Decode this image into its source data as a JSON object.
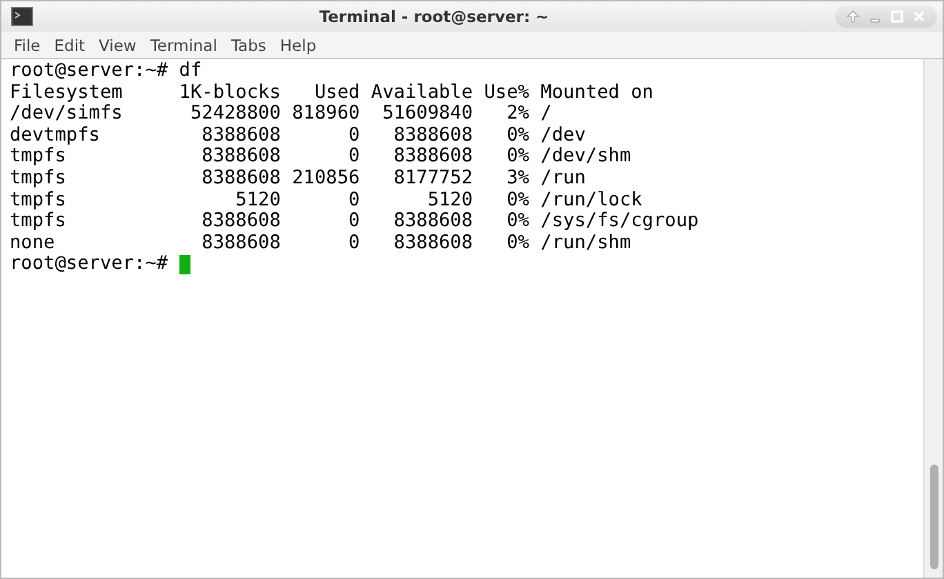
{
  "window": {
    "title": "Terminal - root@server: ~"
  },
  "menu": [
    "File",
    "Edit",
    "View",
    "Terminal",
    "Tabs",
    "Help"
  ],
  "terminal": {
    "lines": [
      "root@server:~# df",
      "Filesystem     1K-blocks   Used Available Use% Mounted on",
      "/dev/simfs      52428800 818960  51609840   2% /",
      "devtmpfs         8388608      0   8388608   0% /dev",
      "tmpfs            8388608      0   8388608   0% /dev/shm",
      "tmpfs            8388608 210856   8177752   3% /run",
      "tmpfs               5120      0      5120   0% /run/lock",
      "tmpfs            8388608      0   8388608   0% /sys/fs/cgroup",
      "none             8388608      0   8388608   0% /run/shm"
    ],
    "prompt": "root@server:~# "
  }
}
